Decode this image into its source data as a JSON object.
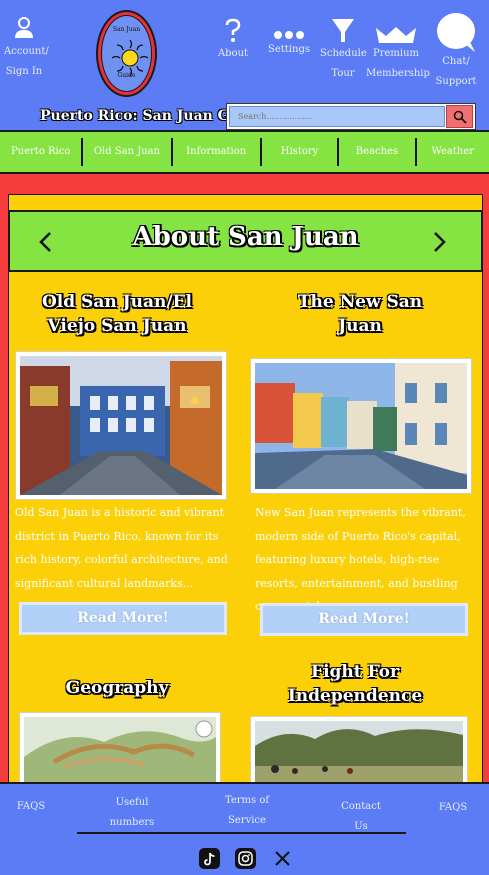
{
  "header": {
    "account_label": "Account/",
    "signin_label": "Sign In",
    "about_label": "About",
    "settings_label": "Settings",
    "schedule_label": "Schedule",
    "tour_label": "Tour",
    "premium_label": "Premium",
    "membership_label": "Membership",
    "chat_label": "Chat/",
    "support_label": "Support",
    "logo_top": "San Juan",
    "logo_bottom": "Guide",
    "site_title": "Puerto Rico: San Juan Guide"
  },
  "search": {
    "placeholder": "Search..................",
    "icon": "search-icon"
  },
  "nav": {
    "items": [
      "Puerto Rico",
      "Old San Juan",
      "Information",
      "History",
      "Beaches",
      "Weather"
    ]
  },
  "main": {
    "section_title": "About San Juan",
    "cards": [
      {
        "title": "Old San Juan/El Viejo San Juan",
        "description": "Old San Juan is a historic and vibrant district in Puerto Rico, known for its rich history, colorful architecture, and significant cultural landmarks...",
        "button_label": "Read More!"
      },
      {
        "title": "The New San Juan",
        "description": "New San Juan represents the vibrant, modern side of Puerto Rico's capital, featuring luxury hotels, high-rise resorts, entertainment, and bustling commercial...",
        "button_label": "Read More!"
      },
      {
        "title": "Geography",
        "description": "",
        "button_label": ""
      },
      {
        "title": "Fight For Independence",
        "description": "",
        "button_label": ""
      }
    ]
  },
  "footer": {
    "links": [
      "FAQS",
      "Useful",
      "numbers",
      "Terms of",
      "Service",
      "Contact Us",
      "FAQS"
    ],
    "social_icons": [
      "tiktok-icon",
      "instagram-icon",
      "x-icon"
    ]
  },
  "colors": {
    "header_bg": "#5b7cf5",
    "nav_bg": "#85e342",
    "main_bg": "#f43c3c",
    "panel_bg": "#fbd009",
    "button_bg": "#b3d1f8",
    "search_button": "#f07070"
  }
}
